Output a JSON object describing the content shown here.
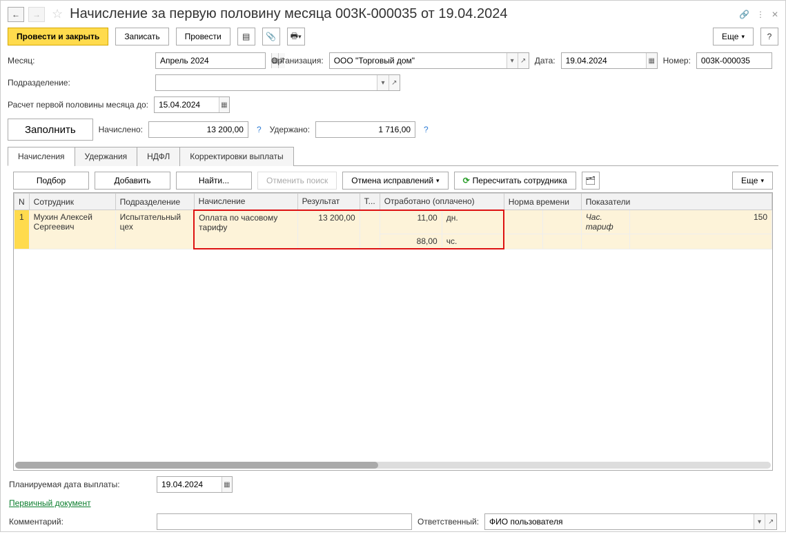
{
  "title": "Начисление за первую половину месяца 003К-000035 от 19.04.2024",
  "toolbar": {
    "post_close": "Провести и закрыть",
    "save": "Записать",
    "post": "Провести",
    "more": "Еще"
  },
  "fields": {
    "month_label": "Месяц:",
    "month_value": "Апрель 2024",
    "org_label": "Организация:",
    "org_value": "ООО \"Торговый дом\"",
    "date_label": "Дата:",
    "date_value": "19.04.2024",
    "number_label": "Номер:",
    "number_value": "003К-000035",
    "dept_label": "Подразделение:",
    "dept_value": "",
    "calc_until_label": "Расчет первой половины месяца до:",
    "calc_until_value": "15.04.2024",
    "fill_btn": "Заполнить",
    "accrued_label": "Начислено:",
    "accrued_value": "13 200,00",
    "withheld_label": "Удержано:",
    "withheld_value": "1 716,00",
    "planned_pay_label": "Планируемая дата выплаты:",
    "planned_pay_value": "19.04.2024",
    "primary_doc_link": "Первичный документ",
    "comment_label": "Комментарий:",
    "responsible_label": "Ответственный:",
    "responsible_value": "ФИО пользователя"
  },
  "tabs": [
    "Начисления",
    "Удержания",
    "НДФЛ",
    "Корректировки выплаты"
  ],
  "table_toolbar": {
    "pick": "Подбор",
    "add": "Добавить",
    "find": "Найти...",
    "cancel_find": "Отменить поиск",
    "cancel_corr": "Отмена исправлений",
    "recalc": "Пересчитать сотрудника",
    "more": "Еще"
  },
  "grid": {
    "headers": {
      "n": "N",
      "employee": "Сотрудник",
      "dept": "Подразделение",
      "accrual": "Начисление",
      "result": "Результат",
      "t": "Т...",
      "worked": "Отработано (оплачено)",
      "norm": "Норма времени",
      "indicators": "Показатели"
    },
    "row": {
      "n": "1",
      "employee": "Мухин Алексей Сергеевич",
      "dept": "Испытательный цех",
      "accrual": "Оплата по часовому тарифу",
      "result": "13 200,00",
      "worked_days_val": "11,00",
      "worked_days_unit": "дн.",
      "worked_hours_val": "88,00",
      "worked_hours_unit": "чс.",
      "indicator_name": "Час. тариф",
      "indicator_val": "150"
    }
  }
}
